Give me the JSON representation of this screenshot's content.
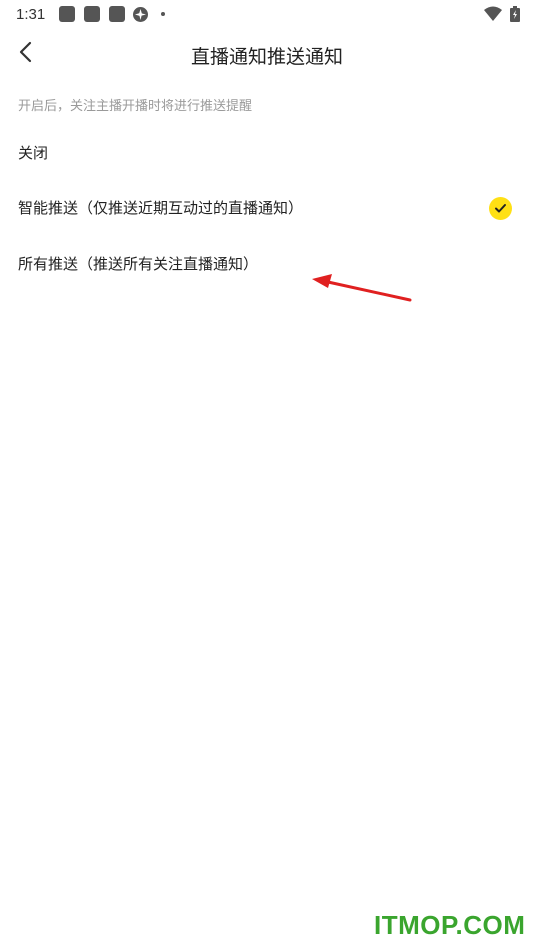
{
  "status_bar": {
    "time": "1:31",
    "icons": [
      "app-icon",
      "app-icon",
      "app-icon",
      "settings-icon",
      "dot-icon",
      "wifi-icon",
      "battery-icon"
    ]
  },
  "header": {
    "back_icon": "chevron-left-icon",
    "title": "直播通知推送通知"
  },
  "hint": "开启后，关注主播开播时将进行推送提醒",
  "options": [
    {
      "label": "关闭",
      "selected": false
    },
    {
      "label": "智能推送（仅推送近期互动过的直播通知）",
      "selected": true
    },
    {
      "label": "所有推送（推送所有关注直播通知）",
      "selected": false
    }
  ],
  "colors": {
    "check_bg": "#ffe014",
    "annotation_arrow": "#e02020",
    "watermark": "#3aa52e"
  },
  "watermark": "ITMOP.COM"
}
